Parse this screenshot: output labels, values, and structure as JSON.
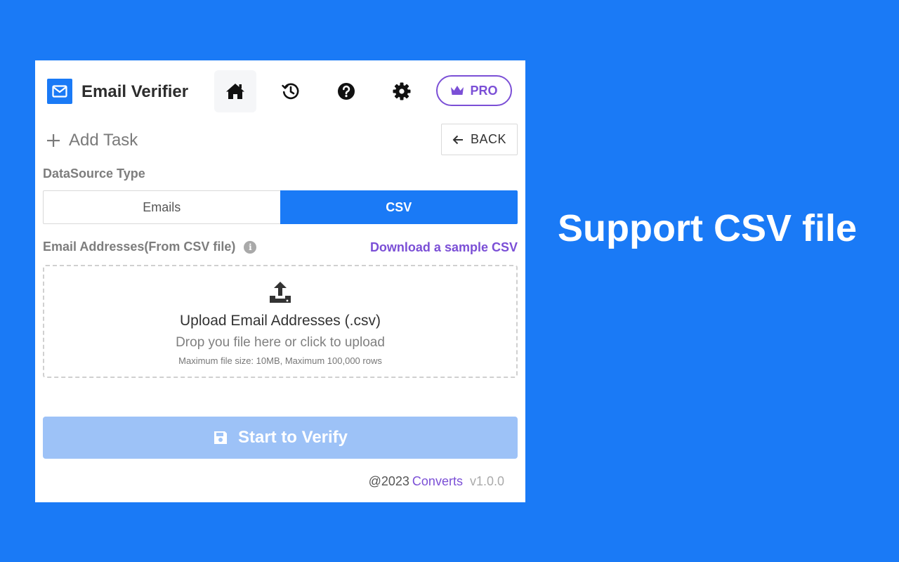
{
  "app": {
    "title": "Email Verifier",
    "accent_color": "#1a7af6",
    "pro_color": "#7b4fd6"
  },
  "nav": {
    "items": [
      {
        "icon": "home-icon",
        "active": true
      },
      {
        "icon": "history-icon",
        "active": false
      },
      {
        "icon": "help-icon",
        "active": false
      },
      {
        "icon": "gear-icon",
        "active": false
      }
    ],
    "pro_label": "PRO"
  },
  "task": {
    "add_label": "Add Task",
    "back_label": "BACK"
  },
  "datasource": {
    "label": "DataSource Type",
    "options": [
      "Emails",
      "CSV"
    ],
    "selected": "CSV"
  },
  "emails": {
    "label": "Email Addresses(From CSV file)",
    "info_glyph": "i",
    "sample_link": "Download a sample CSV"
  },
  "upload": {
    "title": "Upload Email Addresses (.csv)",
    "subtitle": "Drop you file here or click to upload",
    "hint": "Maximum file size: 10MB, Maximum 100,000 rows"
  },
  "actions": {
    "verify_label": "Start to Verify"
  },
  "footer": {
    "copyright": "@2023",
    "brand": "Converts",
    "version": "v1.0.0"
  },
  "promo": {
    "headline": "Support CSV file"
  }
}
